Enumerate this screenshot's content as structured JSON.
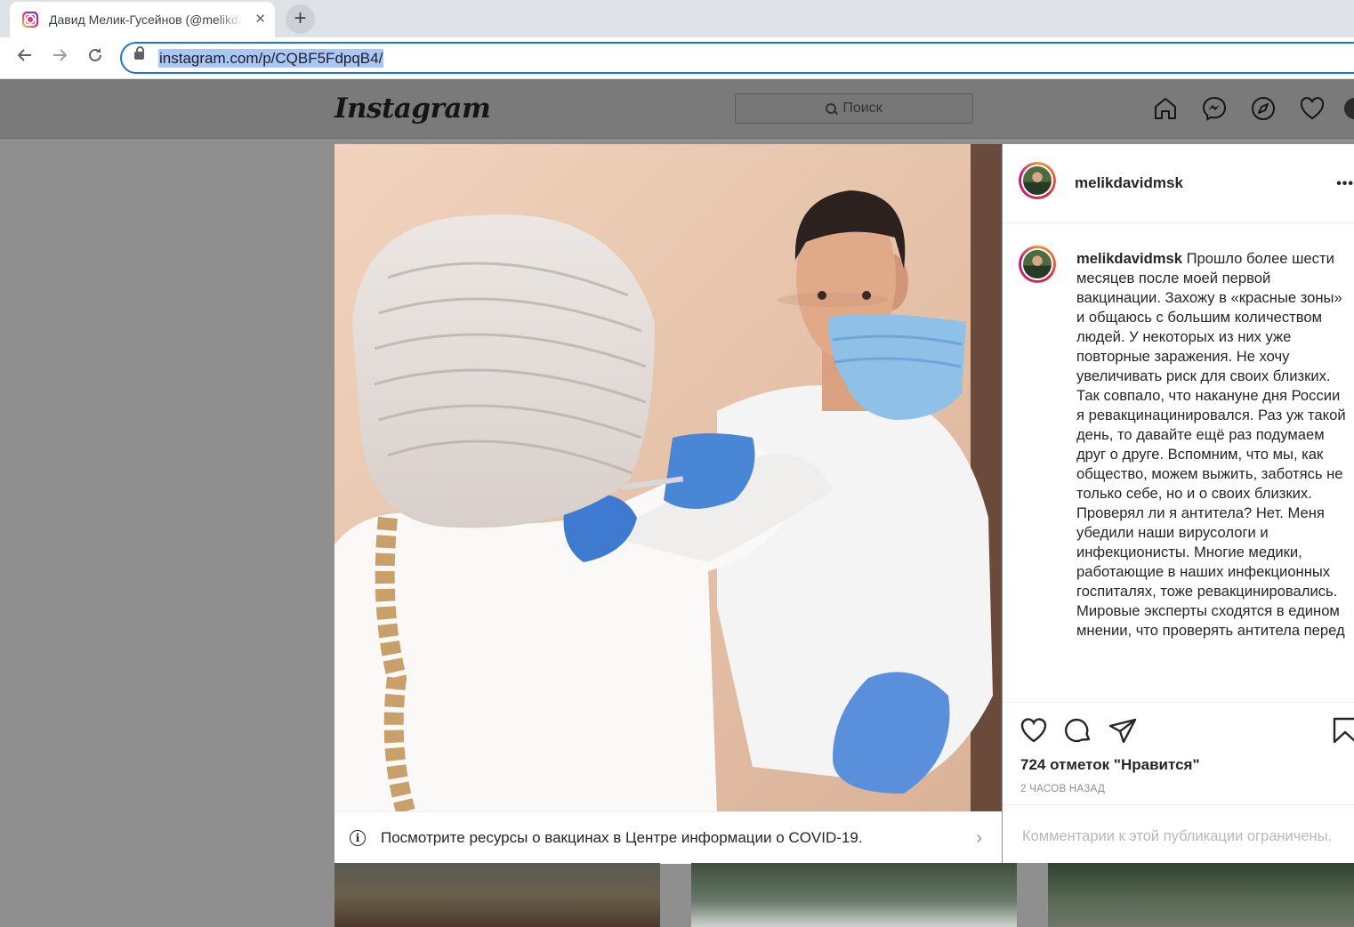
{
  "browser": {
    "tab_title": "Давид Мелик-Гусейнов (@melikdavidmsk)",
    "tab_close": "✕",
    "new_tab": "+",
    "url": "instagram.com/p/CQBF5FdpqB4/"
  },
  "header": {
    "logo": "Instagram",
    "search_placeholder": "Поиск"
  },
  "post": {
    "username": "melikdavidmsk",
    "more": "•••",
    "caption_username": "melikdavidmsk",
    "caption_paragraph1": "Прошло более шести месяцев после моей первой вакцинации. Захожу в «красные зоны» и общаюсь с большим количеством людей. У некоторых из них уже повторные заражения. Не хочу увеличивать риск для своих близких. Так совпало, что накануне дня России я ревакцинацинировался. Раз уж такой день, то давайте ещё раз подумаем друг о друге. Вспомним, что мы, как общество, можем выжить, заботясь не только себе, но и о своих близких.",
    "caption_paragraph2": "Проверял ли я антитела? Нет. Меня убедили наши вирусологи и инфекционисты. Многие медики, работающие в наших инфекционных госпиталях, тоже ревакцинировались. Мировые эксперты сходятся в едином мнении, что проверять антитела перед",
    "likes": "724 отметок \"Нравится\"",
    "time_ago": "2 ЧАСОВ НАЗАД",
    "comments_disabled": "Комментарии к этой публикации ограничены.",
    "covid_banner": "Посмотрите ресурсы о вакцинах в Центре информации о COVID-19.",
    "info_glyph": "i",
    "chevron": "›"
  },
  "colors": {
    "accent_blue": "#1a73e8",
    "url_highlight": "#a8c7fa",
    "text_dark": "#262626",
    "text_muted": "#8e8e8e"
  }
}
